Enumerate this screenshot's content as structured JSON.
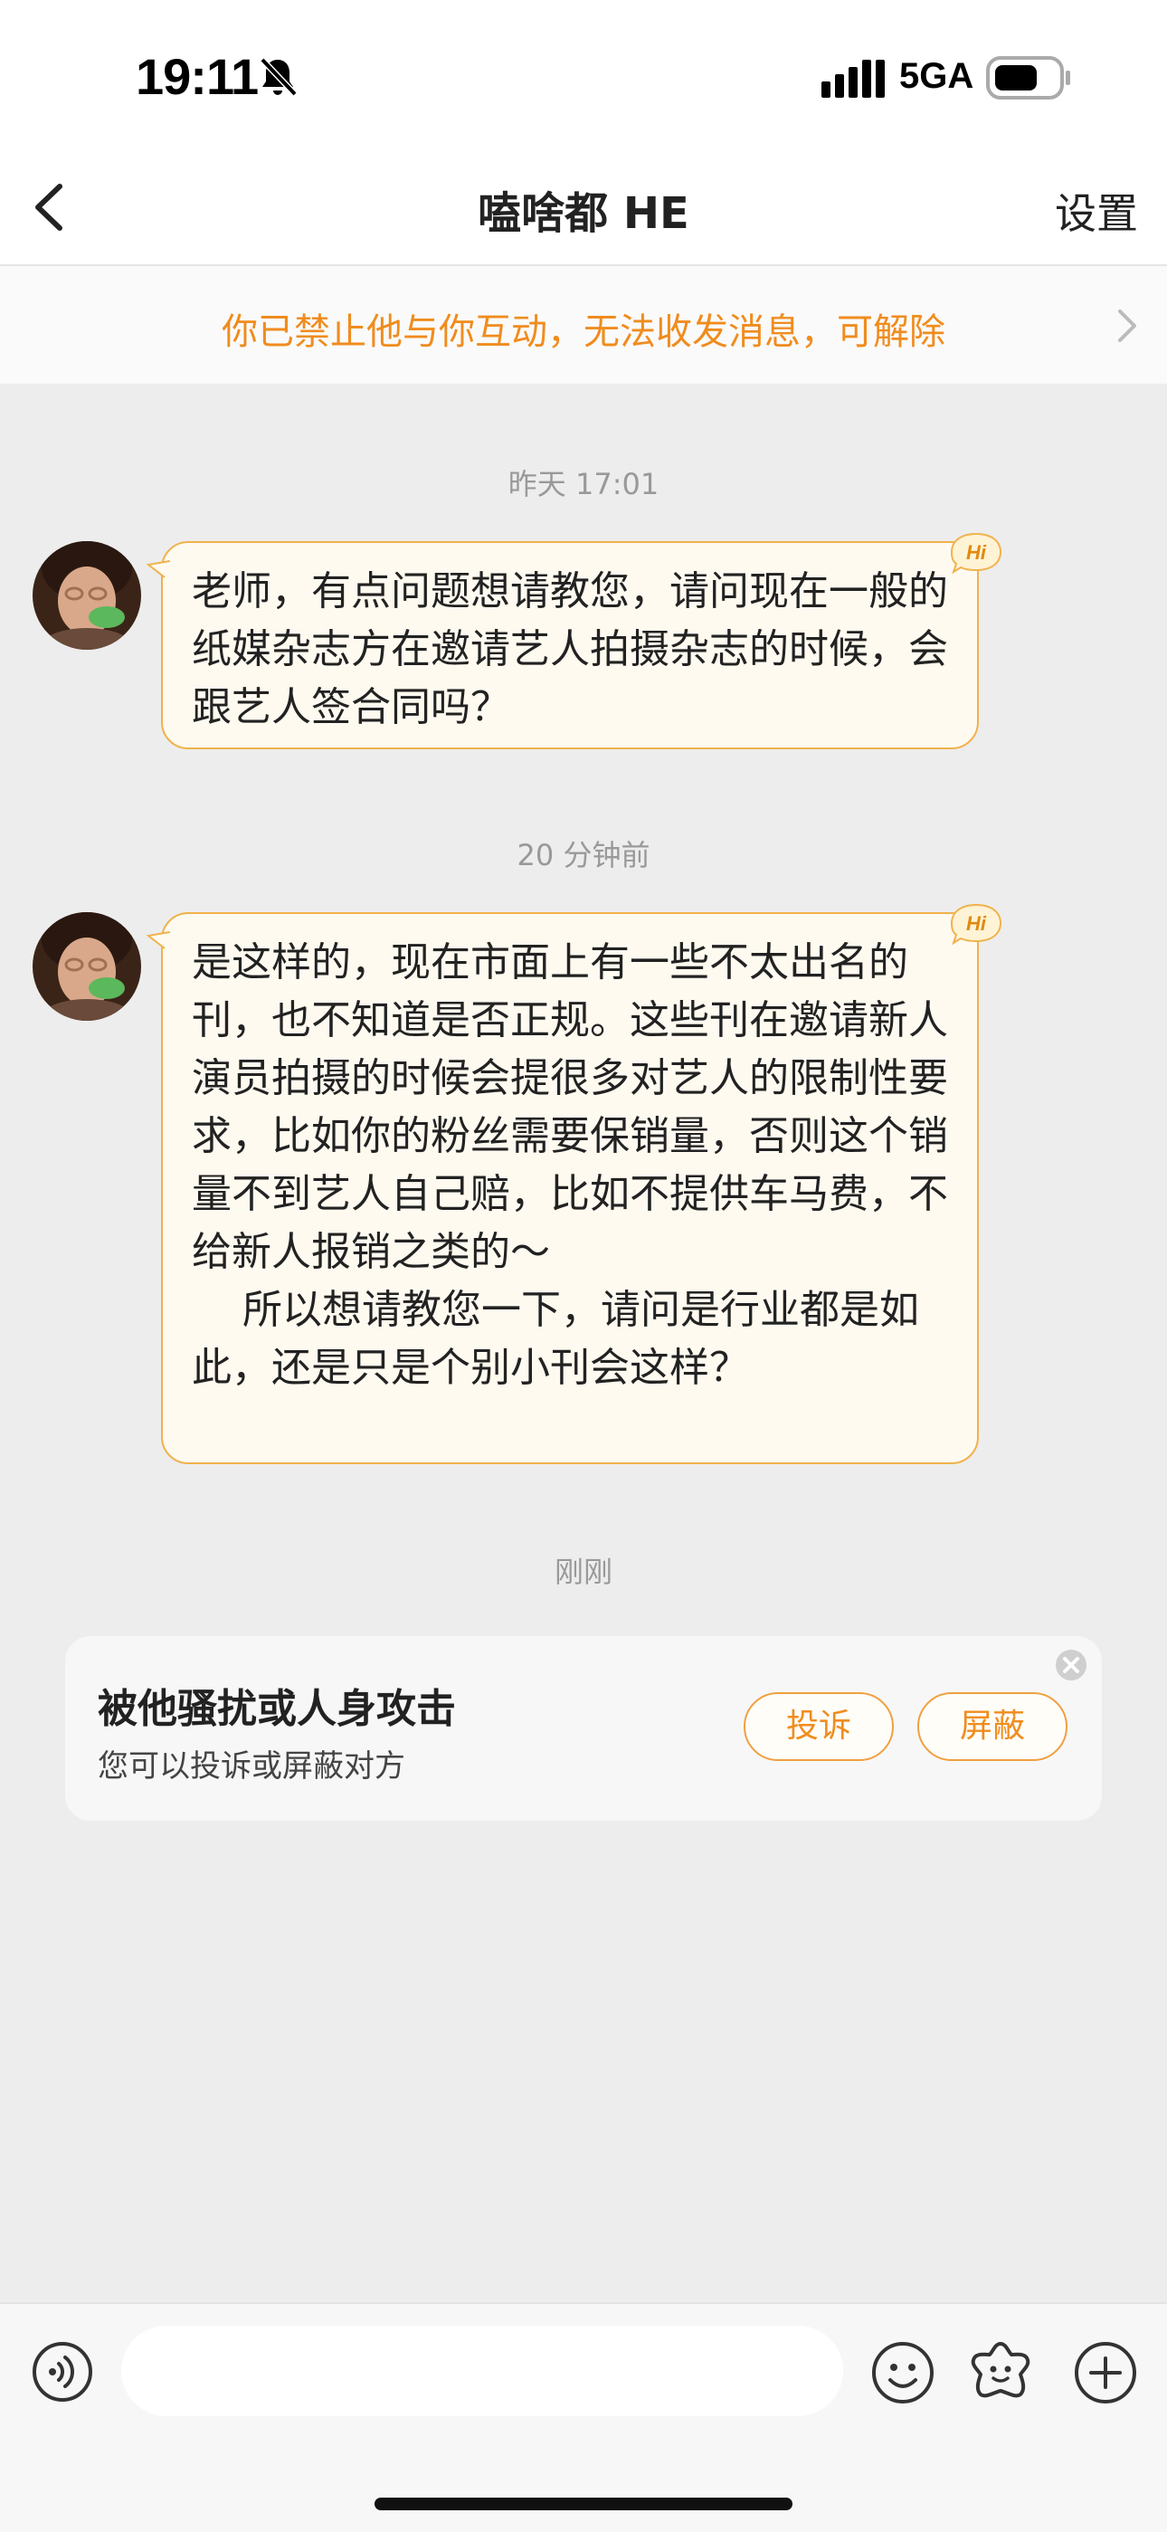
{
  "status_bar": {
    "time": "19:11",
    "network": "5GA",
    "icons": [
      "mute-bell-icon",
      "signal-bars-icon",
      "battery-icon"
    ]
  },
  "nav": {
    "title": "嗑啥都 HE",
    "settings_label": "设置",
    "back_icon": "chevron-left-icon"
  },
  "banner": {
    "text": "你已禁止他与你互动，无法收发消息，可解除",
    "icon": "chevron-right-icon"
  },
  "messages": [
    {
      "timestamp": "昨天 17:01",
      "sender": "other",
      "text": "老师，有点问题想请教您，请问现在一般的纸媒杂志方在邀请艺人拍摄杂志的时候，会跟艺人签合同吗？",
      "badge": "Hi"
    },
    {
      "timestamp": "20 分钟前",
      "sender": "other",
      "text": "是这样的，现在市面上有一些不太出名的刊，也不知道是否正规。这些刊在邀请新人演员拍摄的时候会提很多对艺人的限制性要求，比如你的粉丝需要保销量，否则这个销量不到艺人自己赔，比如不提供车马费，不给新人报销之类的～\n    所以想请教您一下，请问是行业都是如此，还是只是个别小刊会这样？",
      "badge": "Hi"
    }
  ],
  "report_card": {
    "timestamp": "刚刚",
    "title": "被他骚扰或人身攻击",
    "subtitle": "您可以投诉或屏蔽对方",
    "complain_label": "投诉",
    "block_label": "屏蔽"
  },
  "input_bar": {
    "placeholder": "",
    "icons": [
      "voice-icon",
      "emoji-icon",
      "sticker-icon",
      "plus-icon"
    ]
  },
  "colors": {
    "accent": "#f08c1e",
    "bubble_bg": "#fffaf0",
    "bubble_border": "#f0b24c",
    "chat_bg": "#ededed"
  }
}
